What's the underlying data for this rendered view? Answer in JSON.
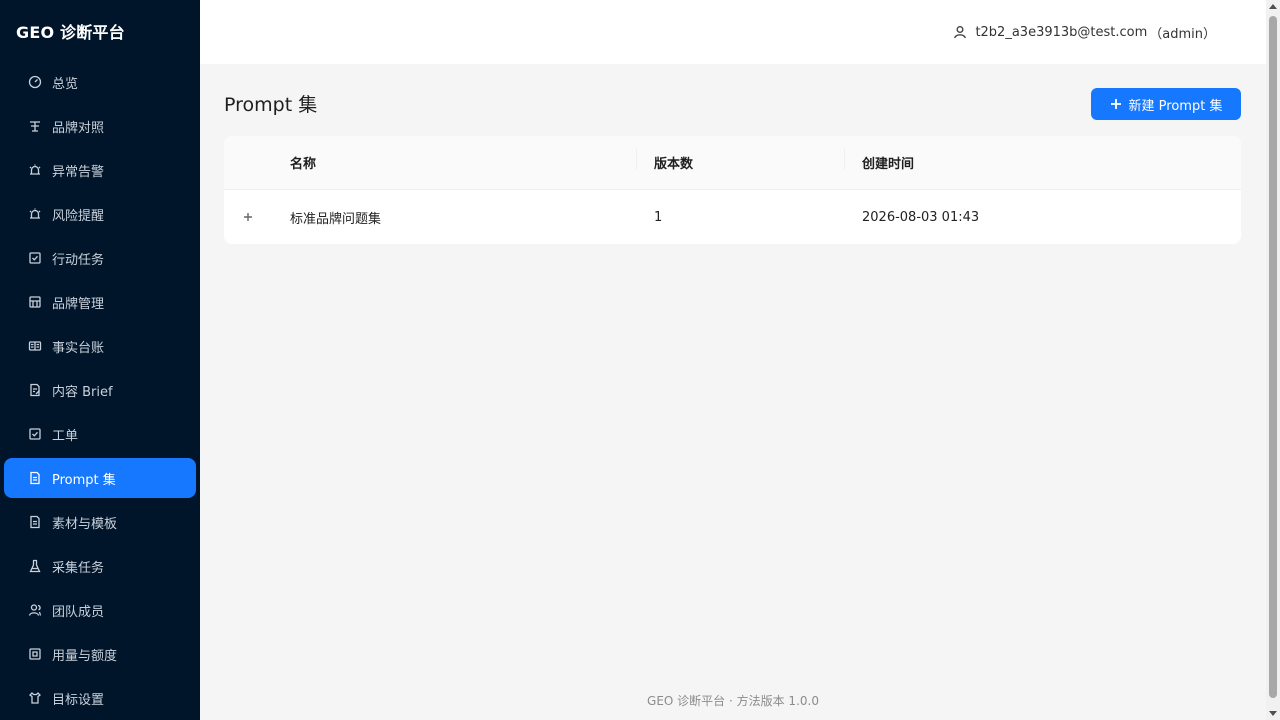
{
  "app": {
    "logo_text": "GEO 诊断平台"
  },
  "sidebar": {
    "items": [
      {
        "label": "总览",
        "icon": "dashboard-icon",
        "active": false
      },
      {
        "label": "品牌对照",
        "icon": "compare-icon",
        "active": false
      },
      {
        "label": "异常告警",
        "icon": "alert-icon",
        "active": false
      },
      {
        "label": "风险提醒",
        "icon": "bell-icon",
        "active": false
      },
      {
        "label": "行动任务",
        "icon": "check-square-icon",
        "active": false
      },
      {
        "label": "品牌管理",
        "icon": "brand-icon",
        "active": false
      },
      {
        "label": "事实台账",
        "icon": "ledger-icon",
        "active": false
      },
      {
        "label": "内容 Brief",
        "icon": "document-edit-icon",
        "active": false
      },
      {
        "label": "工单",
        "icon": "ticket-icon",
        "active": false
      },
      {
        "label": "Prompt 集",
        "icon": "file-icon",
        "active": true
      },
      {
        "label": "素材与模板",
        "icon": "file-template-icon",
        "active": false
      },
      {
        "label": "采集任务",
        "icon": "flask-icon",
        "active": false
      },
      {
        "label": "团队成员",
        "icon": "team-icon",
        "active": false
      },
      {
        "label": "用量与额度",
        "icon": "quota-icon",
        "active": false
      },
      {
        "label": "目标设置",
        "icon": "target-icon",
        "active": false
      }
    ]
  },
  "header": {
    "user_email": "t2b2_a3e3913b@test.com",
    "user_role": "（admin）"
  },
  "main": {
    "page_title": "Prompt 集",
    "new_button_label": "新建 Prompt 集",
    "table": {
      "columns": [
        "名称",
        "版本数",
        "创建时间"
      ],
      "rows": [
        {
          "name": "标准品牌问题集",
          "versions": "1",
          "created": "2026-08-03 01:43"
        }
      ]
    }
  },
  "footer": {
    "text": "GEO 诊断平台 · 方法版本 1.0.0"
  },
  "colors": {
    "sidebar_bg": "#001529",
    "accent": "#1677ff",
    "page_bg": "#f5f5f5"
  }
}
